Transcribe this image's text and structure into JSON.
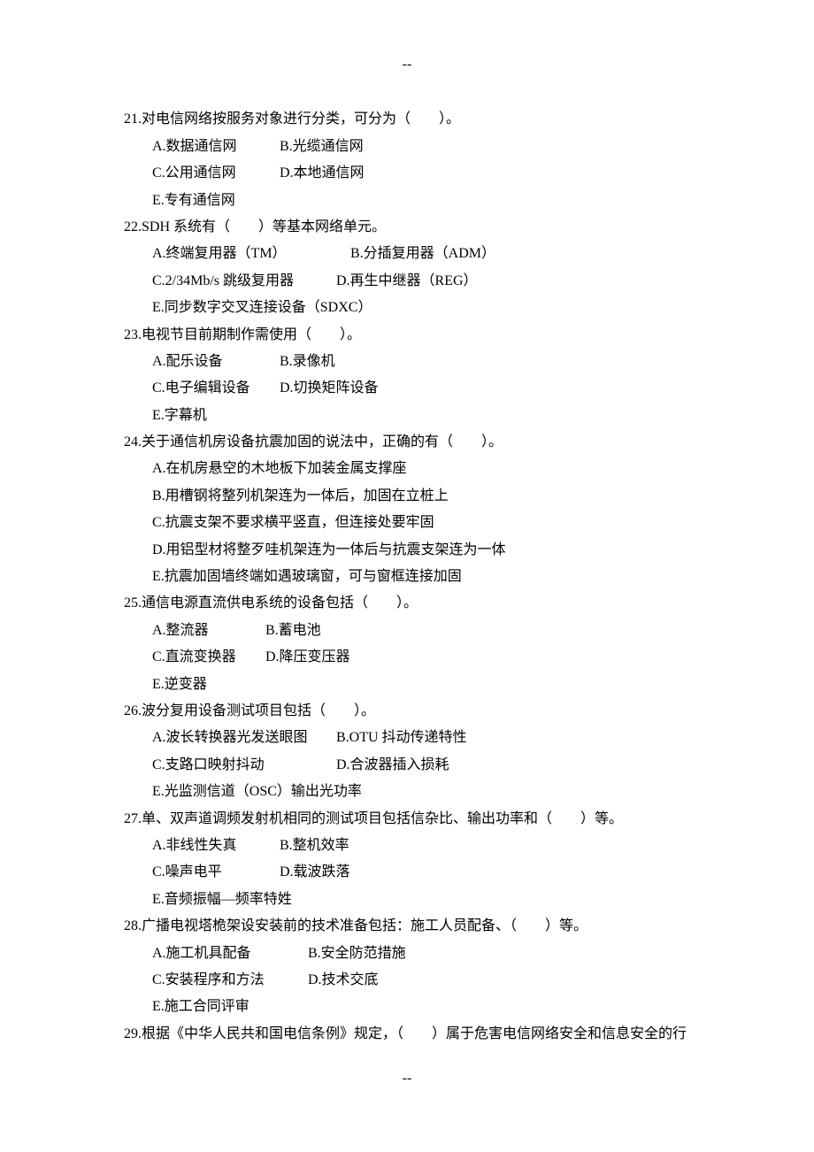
{
  "dashes": "--",
  "questions": [
    {
      "num": "21.",
      "stem": "对电信网络按服务对象进行分类，可分为（　　）。",
      "rows": [
        [
          {
            "w": "9em",
            "t": "A.数据通信网"
          },
          {
            "w": "auto",
            "t": "B.光缆通信网"
          }
        ],
        [
          {
            "w": "9em",
            "t": "C.公用通信网"
          },
          {
            "w": "auto",
            "t": "D.本地通信网"
          }
        ],
        [
          {
            "w": "auto",
            "t": "E.专有通信网"
          }
        ]
      ]
    },
    {
      "num": "22.",
      "stem": "SDH 系统有（　　）等基本网络单元。",
      "rows": [
        [
          {
            "w": "14em",
            "t": "A.终端复用器（TM）"
          },
          {
            "w": "auto",
            "t": "B.分插复用器（ADM）"
          }
        ],
        [
          {
            "w": "13em",
            "t": "C.2/34Mb/s 跳级复用器"
          },
          {
            "w": "auto",
            "t": "D.再生中继器（REG）"
          }
        ],
        [
          {
            "w": "auto",
            "t": "E.同步数字交叉连接设备（SDXC）"
          }
        ]
      ]
    },
    {
      "num": "23.",
      "stem": "电视节目前期制作需使用（　　）。",
      "rows": [
        [
          {
            "w": "9em",
            "t": "A.配乐设备"
          },
          {
            "w": "auto",
            "t": "B.录像机"
          }
        ],
        [
          {
            "w": "9em",
            "t": "C.电子编辑设备"
          },
          {
            "w": "auto",
            "t": "D.切换矩阵设备"
          }
        ],
        [
          {
            "w": "auto",
            "t": "E.字幕机"
          }
        ]
      ]
    },
    {
      "num": "24.",
      "stem": "关于通信机房设备抗震加固的说法中，正确的有（　　）。",
      "rows": [
        [
          {
            "w": "auto",
            "t": "A.在机房悬空的木地板下加装金属支撑座"
          }
        ],
        [
          {
            "w": "auto",
            "t": "B.用槽钢将整列机架连为一体后，加固在立桩上"
          }
        ],
        [
          {
            "w": "auto",
            "t": "C.抗震支架不要求横平竖直，但连接处要牢固"
          }
        ],
        [
          {
            "w": "auto",
            "t": "D.用铝型材将整歹哇机架连为一体后与抗震支架连为一体"
          }
        ],
        [
          {
            "w": "auto",
            "t": "E.抗震加固墙终端如遇玻璃窗，可与窗框连接加固"
          }
        ]
      ]
    },
    {
      "num": "25.",
      "stem": "通信电源直流供电系统的设备包括（　　）。",
      "rows": [
        [
          {
            "w": "8em",
            "t": "A.整流器"
          },
          {
            "w": "auto",
            "t": "B.蓄电池"
          }
        ],
        [
          {
            "w": "8em",
            "t": "C.直流变换器"
          },
          {
            "w": "auto",
            "t": "D.降压变压器"
          }
        ],
        [
          {
            "w": "auto",
            "t": "E.逆变器"
          }
        ]
      ]
    },
    {
      "num": "26.",
      "stem": "波分复用设备测试项目包括（　　）。",
      "rows": [
        [
          {
            "w": "13em",
            "t": "A.波长转换器光发送眼图"
          },
          {
            "w": "auto",
            "t": "B.OTU 抖动传递特性"
          }
        ],
        [
          {
            "w": "13em",
            "t": "C.支路口映射抖动"
          },
          {
            "w": "auto",
            "t": "D.合波器插入损耗"
          }
        ],
        [
          {
            "w": "auto",
            "t": "E.光监测信道（OSC）输出光功率"
          }
        ]
      ]
    },
    {
      "num": "27.",
      "stem": "单、双声道调频发射机相同的测试项目包括信杂比、输出功率和（　　）等。",
      "rows": [
        [
          {
            "w": "9em",
            "t": "A.非线性失真"
          },
          {
            "w": "auto",
            "t": "B.整机效率"
          }
        ],
        [
          {
            "w": "9em",
            "t": "C.噪声电平"
          },
          {
            "w": "auto",
            "t": "D.载波跌落"
          }
        ],
        [
          {
            "w": "auto",
            "t": "E.音频振幅—频率特姓"
          }
        ]
      ]
    },
    {
      "num": "28.",
      "stem": "广播电视塔桅架设安装前的技术准备包括：施工人员配备、（　　）等。",
      "rows": [
        [
          {
            "w": "11em",
            "t": "A.施工机具配备"
          },
          {
            "w": "auto",
            "t": "B.安全防范措施"
          }
        ],
        [
          {
            "w": "11em",
            "t": "C.安装程序和方法"
          },
          {
            "w": "auto",
            "t": "D.技术交底"
          }
        ],
        [
          {
            "w": "auto",
            "t": "E.施工合同评审"
          }
        ]
      ]
    },
    {
      "num": "29.",
      "stem": "根据《中华人民共和国电信条例》规定，（　　）属于危害电信网络安全和信息安全的行",
      "rows": []
    }
  ]
}
